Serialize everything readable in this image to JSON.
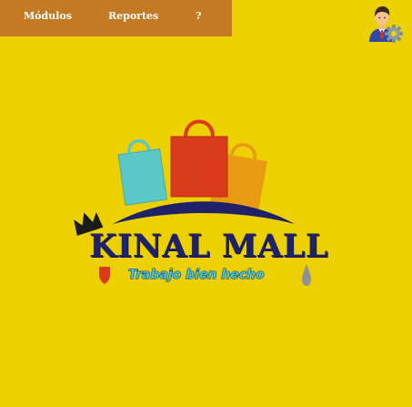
{
  "menu": {
    "modulos": "Módulos",
    "reportes": "Reportes",
    "help": "?"
  },
  "user_icon": "user-settings-icon",
  "logo": {
    "title": "KINAL MALL",
    "subtitle": "Trabajo bien hecho"
  },
  "colors": {
    "background": "#ecd000",
    "menubar": "#c47a22",
    "logo_navy": "#1f2266",
    "bag_teal": "#5bc7c6",
    "bag_red": "#d93a1a",
    "bag_orange": "#e89b12"
  }
}
